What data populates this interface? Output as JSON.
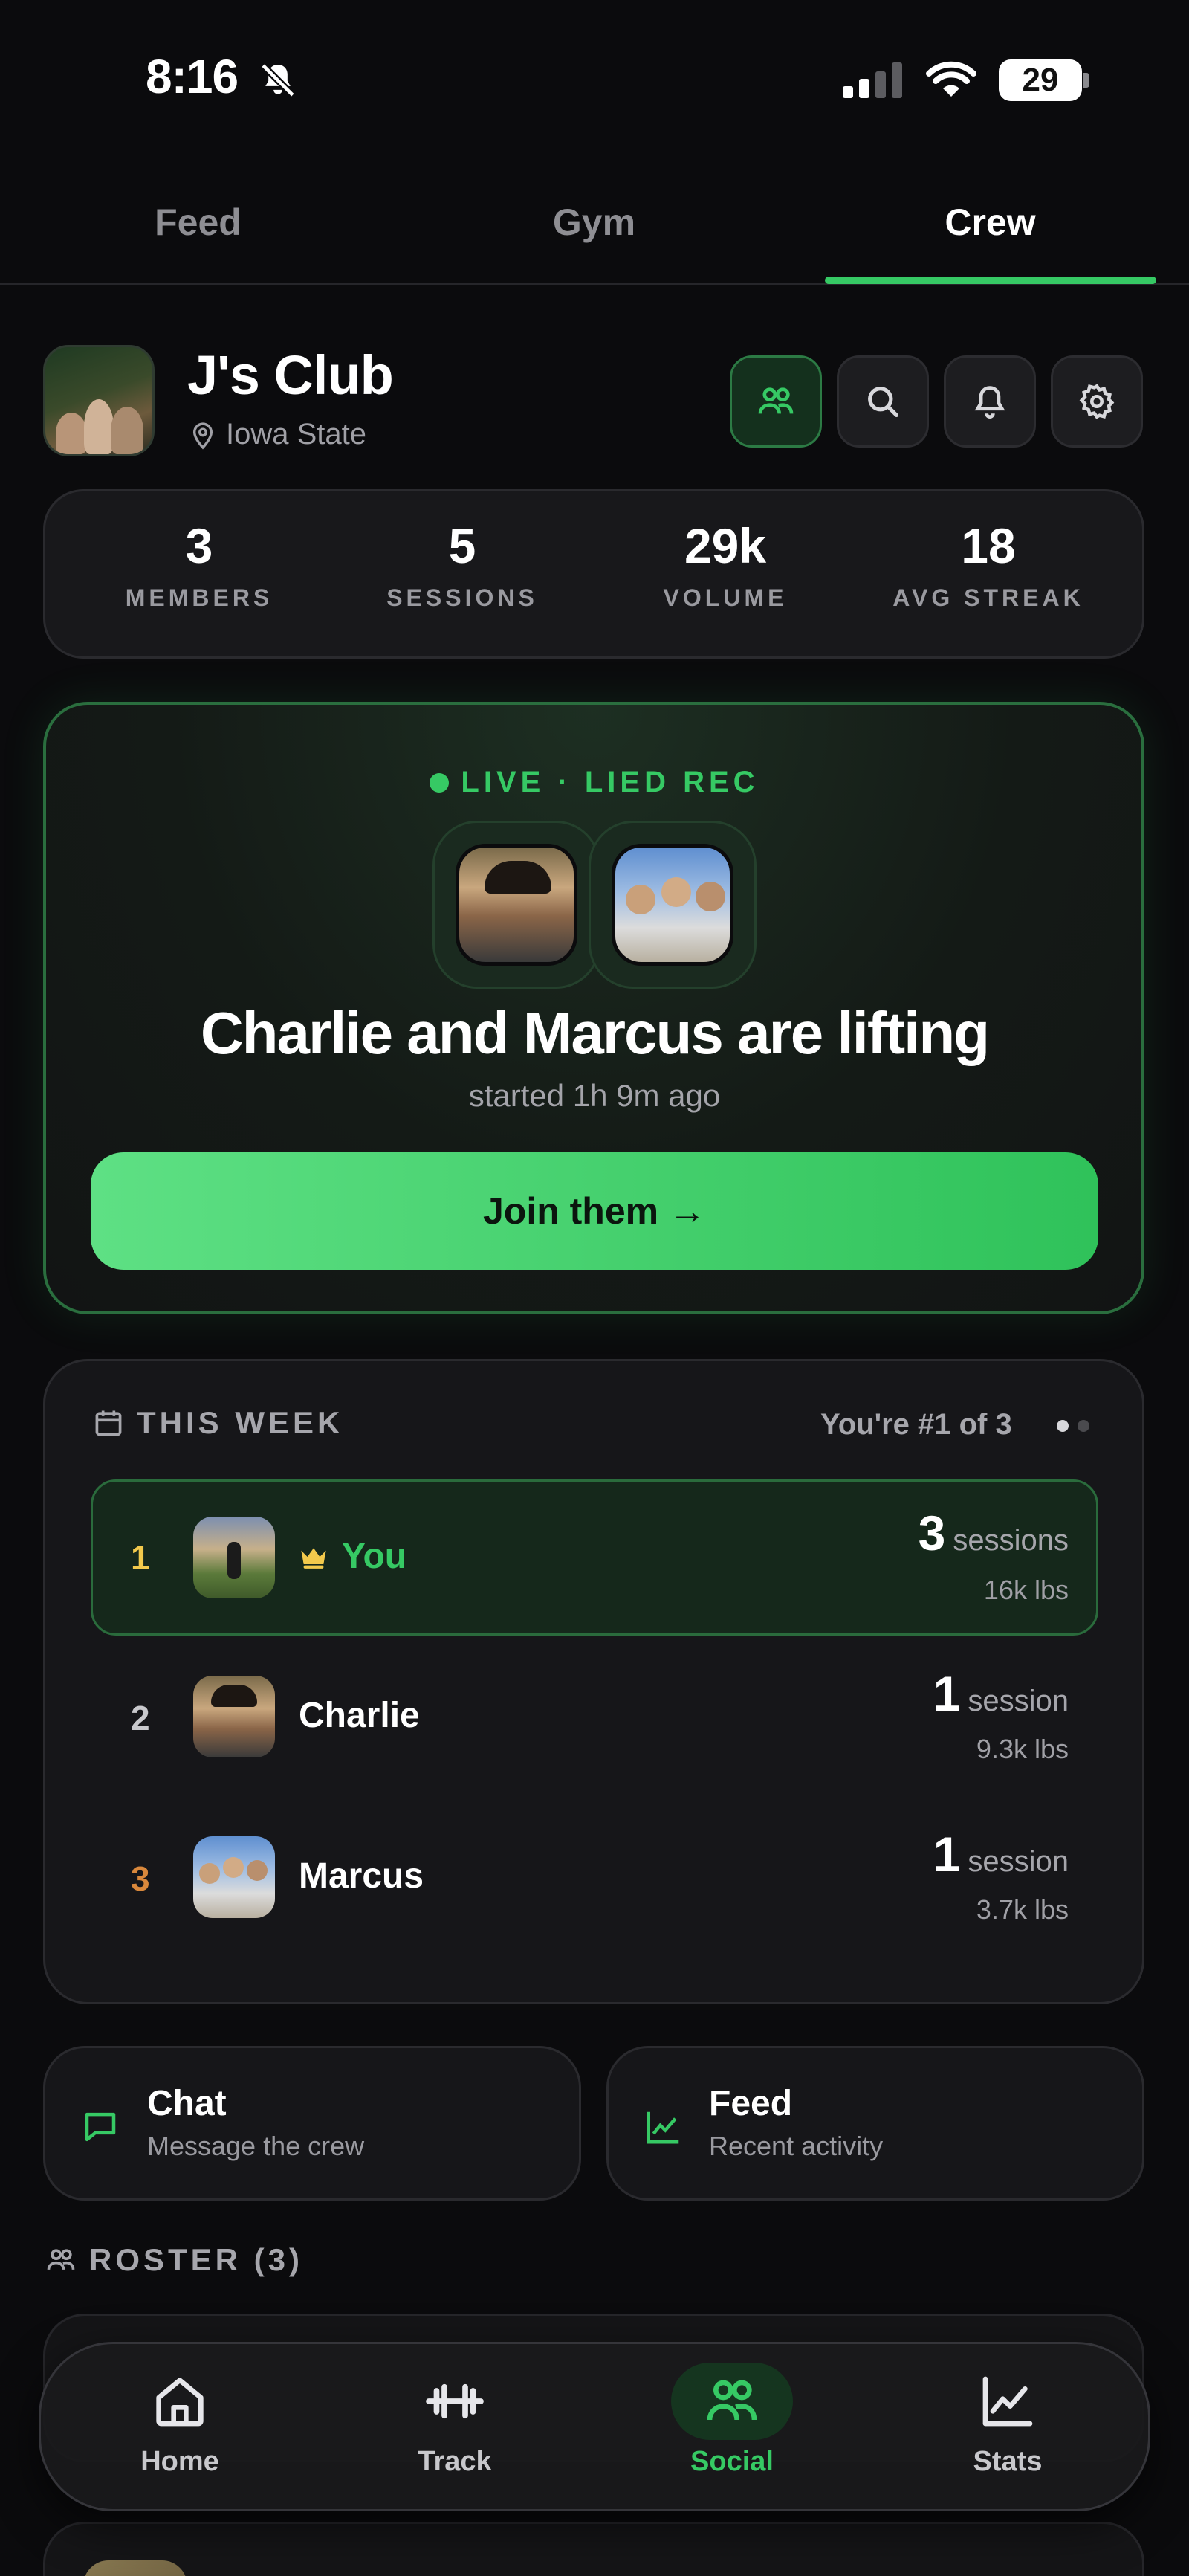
{
  "status_bar": {
    "time": "8:16",
    "battery": "29"
  },
  "top_tabs": [
    {
      "label": "Feed"
    },
    {
      "label": "Gym"
    },
    {
      "label": "Crew"
    }
  ],
  "club": {
    "name": "J's Club",
    "location": "Iowa State"
  },
  "stats": [
    {
      "value": "3",
      "label": "MEMBERS"
    },
    {
      "value": "5",
      "label": "SESSIONS"
    },
    {
      "value": "29k",
      "label": "VOLUME"
    },
    {
      "value": "18",
      "label": "AVG STREAK"
    }
  ],
  "live": {
    "label": "LIVE · LIED REC",
    "title": "Charlie and Marcus are lifting",
    "subtitle": "started 1h 9m ago",
    "join_label": "Join them →"
  },
  "week": {
    "heading": "THIS WEEK",
    "rank_text": "You're #1 of 3",
    "rows": [
      {
        "pos": "1",
        "name": "You",
        "count": "3",
        "unit": "sessions",
        "lbs": "16k lbs"
      },
      {
        "pos": "2",
        "name": "Charlie",
        "count": "1",
        "unit": "session",
        "lbs": "9.3k lbs"
      },
      {
        "pos": "3",
        "name": "Marcus",
        "count": "1",
        "unit": "session",
        "lbs": "3.7k lbs"
      }
    ]
  },
  "quick_actions": [
    {
      "title": "Chat",
      "subtitle": "Message the crew"
    },
    {
      "title": "Feed",
      "subtitle": "Recent activity"
    }
  ],
  "roster": {
    "heading": "ROSTER (3)"
  },
  "bottom_nav": [
    {
      "label": "Home"
    },
    {
      "label": "Track"
    },
    {
      "label": "Social"
    },
    {
      "label": "Stats"
    }
  ],
  "colors": {
    "accent": "#36c964",
    "background": "#0b0b0d",
    "gold": "#f2c94c",
    "bronze": "#d9883c"
  }
}
